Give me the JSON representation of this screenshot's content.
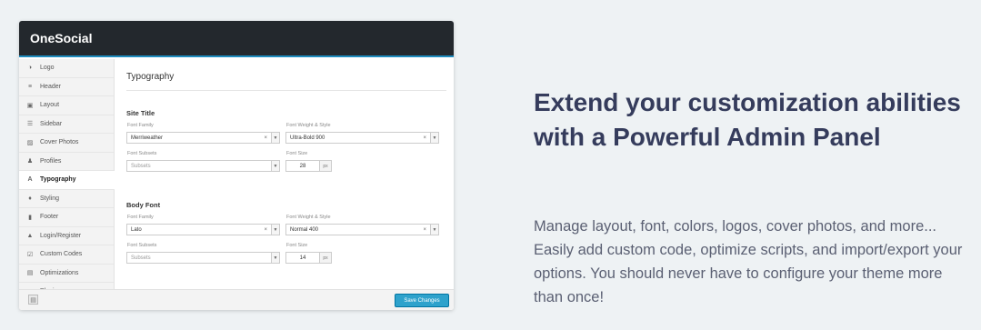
{
  "panel": {
    "app_title": "OneSocial",
    "sidebar": [
      {
        "label": "Logo",
        "icon": "contrast-icon",
        "glyph": "◑"
      },
      {
        "label": "Header",
        "icon": "header-icon",
        "glyph": "≡"
      },
      {
        "label": "Layout",
        "icon": "layout-icon",
        "glyph": "▣"
      },
      {
        "label": "Sidebar",
        "icon": "sidebar-icon",
        "glyph": "☰"
      },
      {
        "label": "Cover Photos",
        "icon": "image-icon",
        "glyph": "▨"
      },
      {
        "label": "Profiles",
        "icon": "user-icon",
        "glyph": "♟"
      },
      {
        "label": "Typography",
        "icon": "font-icon",
        "glyph": "A",
        "active": true
      },
      {
        "label": "Styling",
        "icon": "drop-icon",
        "glyph": "♦"
      },
      {
        "label": "Footer",
        "icon": "bookmark-icon",
        "glyph": "▮"
      },
      {
        "label": "Login/Register",
        "icon": "lock-icon",
        "glyph": "▲"
      },
      {
        "label": "Custom Codes",
        "icon": "code-icon",
        "glyph": "☑"
      },
      {
        "label": "Optimizations",
        "icon": "optimize-icon",
        "glyph": "▤"
      },
      {
        "label": "Plugins",
        "icon": "wrench-icon",
        "glyph": "✎"
      }
    ],
    "section_title": "Typography",
    "site_title": {
      "heading": "Site Title",
      "font_family_label": "Font Family",
      "font_family_value": "Merriweather",
      "weight_label": "Font Weight & Style",
      "weight_value": "Ultra-Bold 900",
      "subsets_label": "Font Subsets",
      "subsets_placeholder": "Subsets",
      "size_label": "Font Size",
      "size_value": "28",
      "size_unit": "px"
    },
    "body_font": {
      "heading": "Body Font",
      "font_family_label": "Font Family",
      "font_family_value": "Lato",
      "weight_label": "Font Weight & Style",
      "weight_value": "Normal 400",
      "subsets_label": "Font Subsets",
      "subsets_placeholder": "Subsets",
      "size_label": "Font Size",
      "size_value": "14",
      "size_unit": "px"
    },
    "clear_glyph": "×",
    "arrow_glyph": "▼",
    "save_label": "Save Changes"
  },
  "headline": "Extend your customization abilities with a Powerful Admin Panel",
  "description": "Manage layout, font, colors, logos, cover photos, and more... Easily add custom code, optimize scripts, and import/export your options. You should never have to configure your theme more than once!",
  "colors": {
    "headline": "#353c5c",
    "topbar": "#23282d",
    "accent": "#2ea2cc",
    "background": "#eef2f4"
  }
}
